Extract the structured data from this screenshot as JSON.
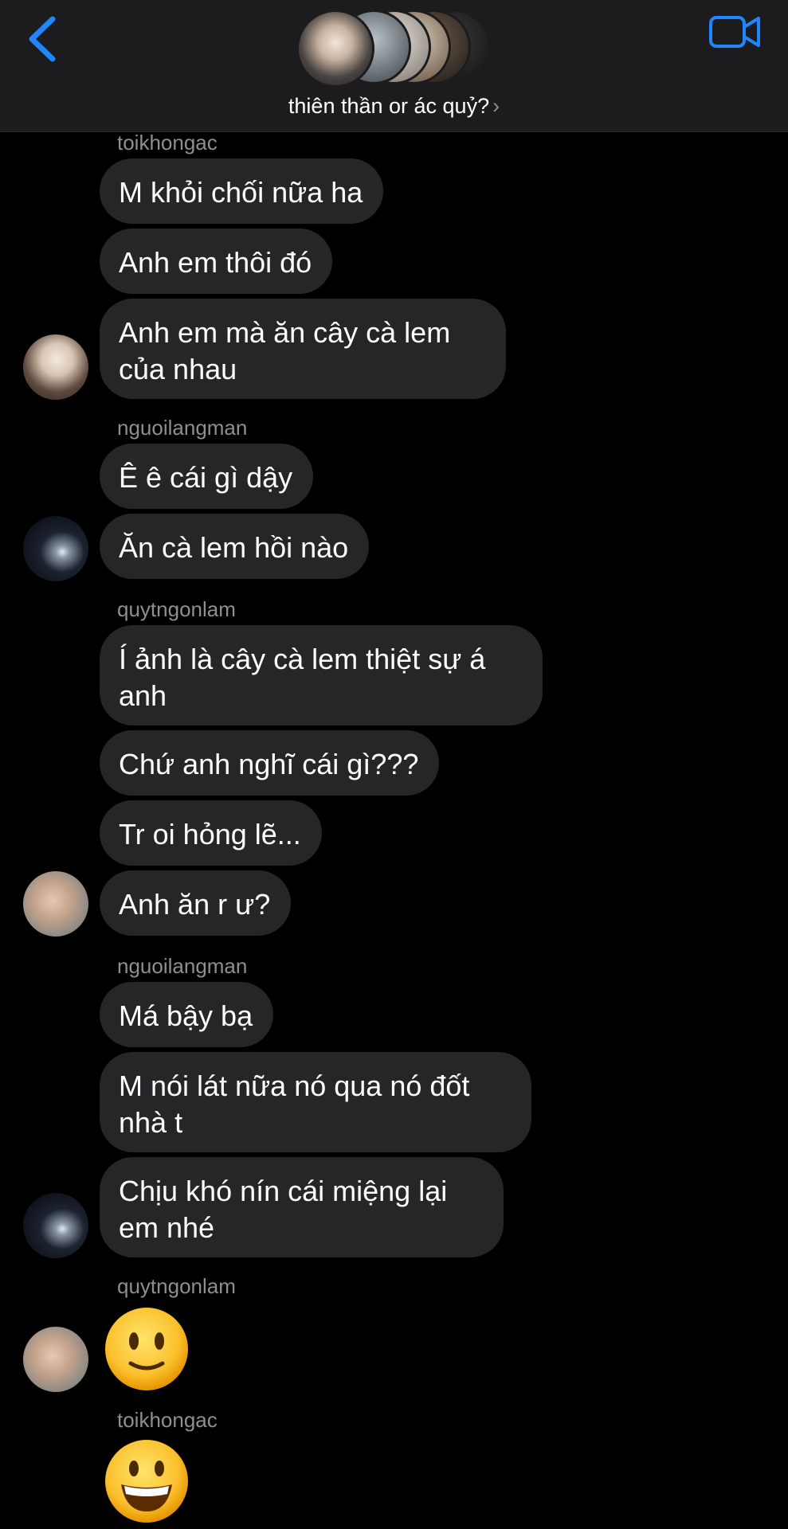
{
  "header": {
    "title": "thiên thần or ác quỷ?",
    "back_icon": "chevron-left-icon",
    "video_icon": "video-call-icon",
    "accent_color": "#1f86ff"
  },
  "messages": [
    {
      "sender": "toikhongac",
      "bubbles": [
        "M khỏi chối nữa ha",
        "Anh em thôi đó",
        "Anh em mà ăn cây cà lem của nhau"
      ]
    },
    {
      "sender": "nguoilangman",
      "bubbles": [
        "Ê ê cái gì dậy",
        "Ăn cà lem hồi nào"
      ]
    },
    {
      "sender": "quytngonlam",
      "bubbles": [
        "Í ảnh là cây cà lem thiệt sự á anh",
        "Chứ anh nghĩ cái gì???",
        "Tr oi hỏng lẽ...",
        "Anh ăn r ư?"
      ]
    },
    {
      "sender": "nguoilangman",
      "bubbles": [
        "Má bậy bạ",
        "M nói lát nữa nó qua nó đốt nhà t",
        "Chịu khó nín cái miệng lại em nhé"
      ]
    },
    {
      "sender": "quytngonlam",
      "emoji": "slightly-smiling-face"
    },
    {
      "sender": "toikhongac",
      "emoji": "grinning-face"
    }
  ]
}
